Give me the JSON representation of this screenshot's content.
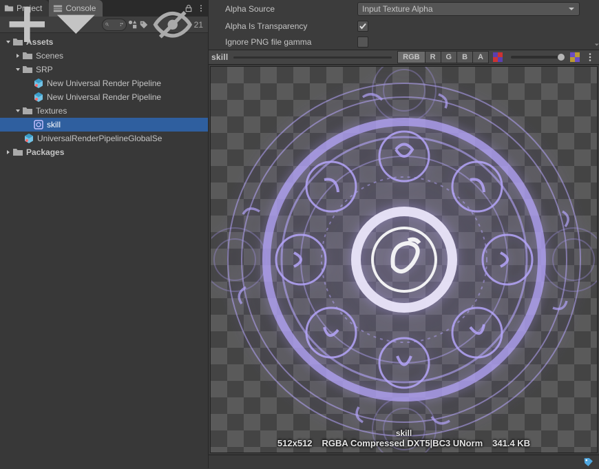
{
  "tabs": {
    "project": "Project",
    "console": "Console"
  },
  "toolbar": {
    "hidden_count": "21"
  },
  "tree": {
    "assets": "Assets",
    "scenes": "Scenes",
    "srp": "SRP",
    "srp_asset1": "New Universal Render Pipeline",
    "srp_asset2": "New Universal Render Pipeline",
    "textures": "Textures",
    "skill": "skill",
    "urp_global": "UniversalRenderPipelineGlobalSe",
    "packages": "Packages"
  },
  "inspector": {
    "alpha_source_label": "Alpha Source",
    "alpha_source_value": "Input Texture Alpha",
    "alpha_is_transparency_label": "Alpha Is Transparency",
    "alpha_is_transparency_value": true,
    "ignore_png_gamma_label": "Ignore PNG file gamma"
  },
  "preview": {
    "title": "skill",
    "channels": {
      "rgb": "RGB",
      "r": "R",
      "g": "G",
      "b": "B",
      "a": "A"
    },
    "asset_name": "skill",
    "dimensions": "512x512",
    "format": "RGBA Compressed DXT5|BC3 UNorm",
    "size": "341.4 KB"
  },
  "icons": {
    "folder": "folder",
    "console": "console",
    "plus": "plus",
    "search": "search",
    "starburst": "starburst",
    "tag": "tag",
    "eye": "eye-off",
    "settings": "settings",
    "cube": "cube",
    "gear": "gear",
    "check": "check",
    "dropdown": "dropdown",
    "lock": "lock",
    "menu": "menu",
    "colorblock": "colorblock"
  }
}
